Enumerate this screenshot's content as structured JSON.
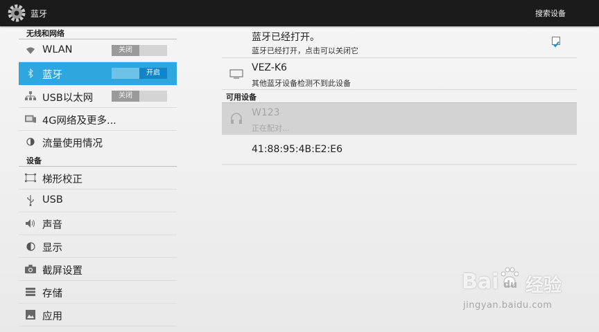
{
  "actionbar": {
    "title": "蓝牙",
    "action": "搜索设备"
  },
  "sections": {
    "wireless": "无线和网络",
    "device": "设备"
  },
  "nav": {
    "wlan": {
      "label": "WLAN",
      "toggle": "关闭"
    },
    "bluetooth": {
      "label": "蓝牙",
      "toggle": "开启"
    },
    "usb_ethernet": {
      "label": "USB以太网",
      "toggle": "关闭"
    },
    "more": {
      "label": "4G网络及更多..."
    },
    "data_usage": {
      "label": "流量使用情况"
    },
    "keystone": {
      "label": "梯形校正"
    },
    "usb": {
      "label": "USB"
    },
    "sound": {
      "label": "声音"
    },
    "display": {
      "label": "显示"
    },
    "screenshot": {
      "label": "截屏设置"
    },
    "storage": {
      "label": "存储"
    },
    "apps": {
      "label": "应用"
    }
  },
  "bluetooth": {
    "status_title": "蓝牙已经打开。",
    "status_sub": "蓝牙已经打开，点击可以关闭它",
    "device_name": "VEZ-K6",
    "device_sub": "其他蓝牙设备检测不到此设备",
    "available_header": "可用设备",
    "available": [
      {
        "name": "W123",
        "status": "正在配对..."
      },
      {
        "name": "41:88:95:4B:E2:E6"
      }
    ]
  },
  "watermark": {
    "brand": "Bai",
    "brand2": "du",
    "cn": "经验",
    "url": "jingyan.baidu.com"
  },
  "colors": {
    "accent": "#2fa6dd",
    "actionbar": "#1b1b1b",
    "pairing_bg": "#d3d3d3"
  }
}
